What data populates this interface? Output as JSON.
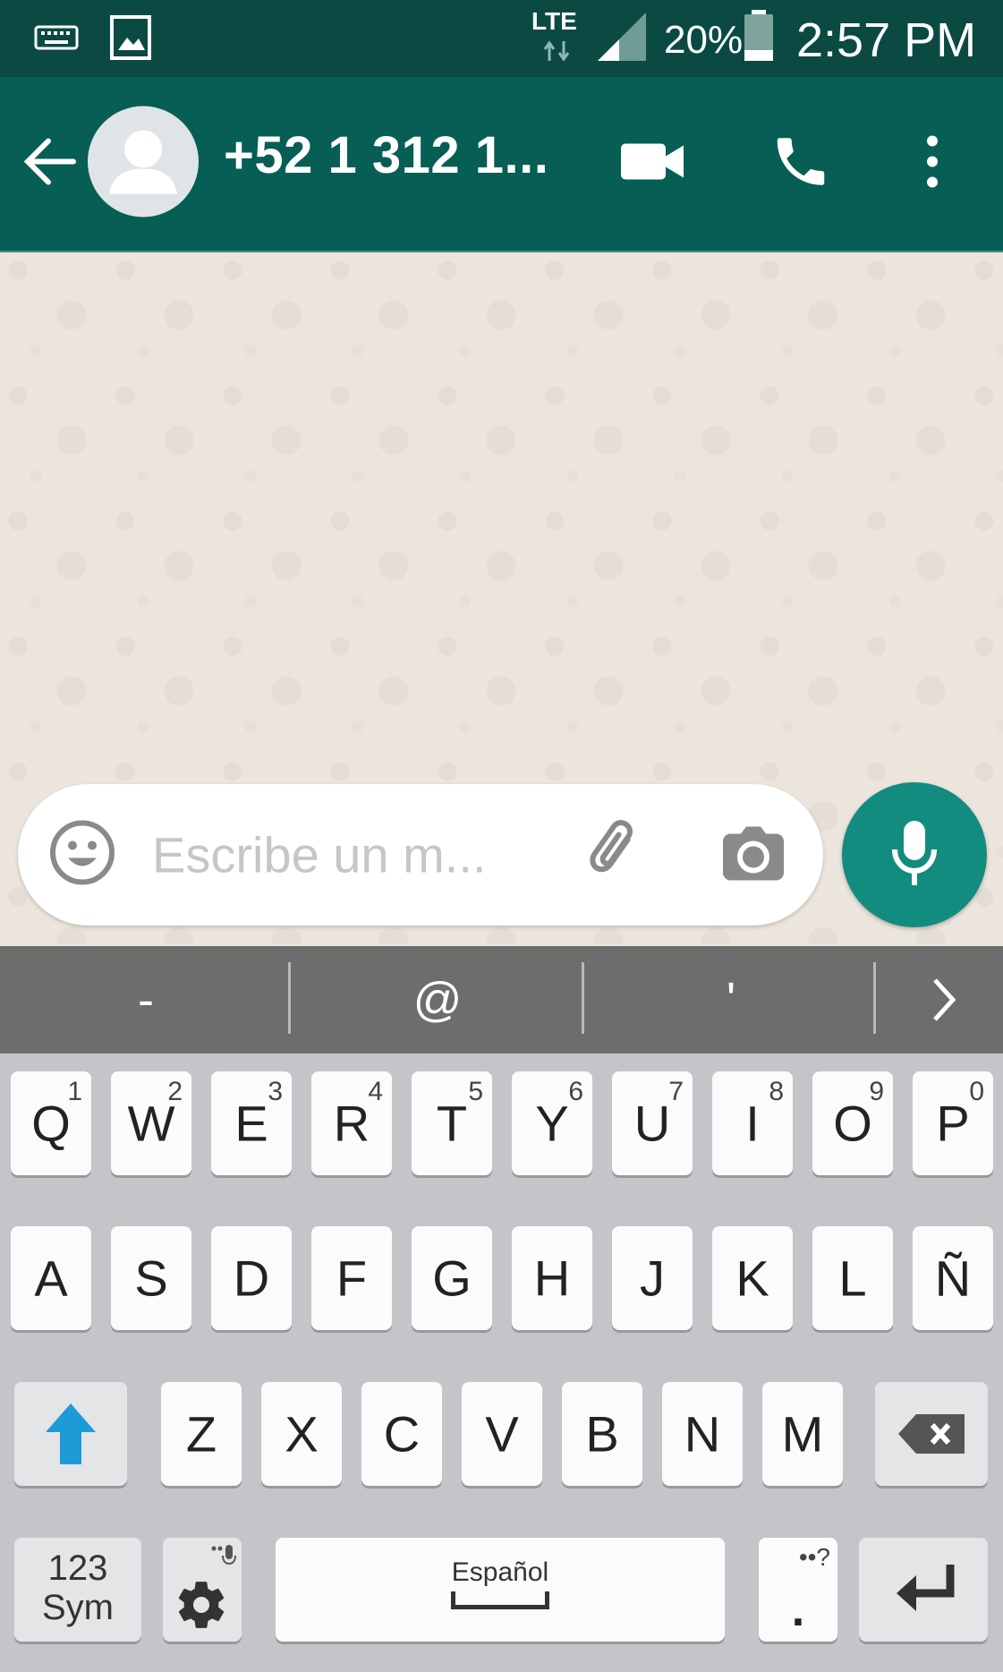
{
  "status_bar": {
    "network_type": "LTE",
    "battery": "20%",
    "time": "2:57 PM",
    "icons": [
      "keyboard-icon",
      "image-icon",
      "signal-icon",
      "battery-icon"
    ]
  },
  "app_bar": {
    "title": "+52 1 312 1...",
    "icons": [
      "back-arrow-icon",
      "avatar-icon",
      "video-call-icon",
      "phone-icon",
      "more-vert-icon"
    ],
    "color": "#075e54"
  },
  "composer": {
    "placeholder": "Escribe un m...",
    "icons": [
      "emoji-icon",
      "attach-icon",
      "camera-icon",
      "mic-icon"
    ],
    "accent": "#128c7e"
  },
  "suggestions": [
    "-",
    "@",
    "'"
  ],
  "keyboard": {
    "row1": [
      {
        "key": "Q",
        "sup": "1"
      },
      {
        "key": "W",
        "sup": "2"
      },
      {
        "key": "E",
        "sup": "3"
      },
      {
        "key": "R",
        "sup": "4"
      },
      {
        "key": "T",
        "sup": "5"
      },
      {
        "key": "Y",
        "sup": "6"
      },
      {
        "key": "U",
        "sup": "7"
      },
      {
        "key": "I",
        "sup": "8"
      },
      {
        "key": "O",
        "sup": "9"
      },
      {
        "key": "P",
        "sup": "0"
      }
    ],
    "row2": [
      "A",
      "S",
      "D",
      "F",
      "G",
      "H",
      "J",
      "K",
      "L",
      "Ñ"
    ],
    "row3": [
      "Z",
      "X",
      "C",
      "V",
      "B",
      "N",
      "M"
    ],
    "sym_line1": "123",
    "sym_line2": "Sym",
    "space_label": "Español",
    "period_key": ".",
    "period_sup": "••?"
  }
}
